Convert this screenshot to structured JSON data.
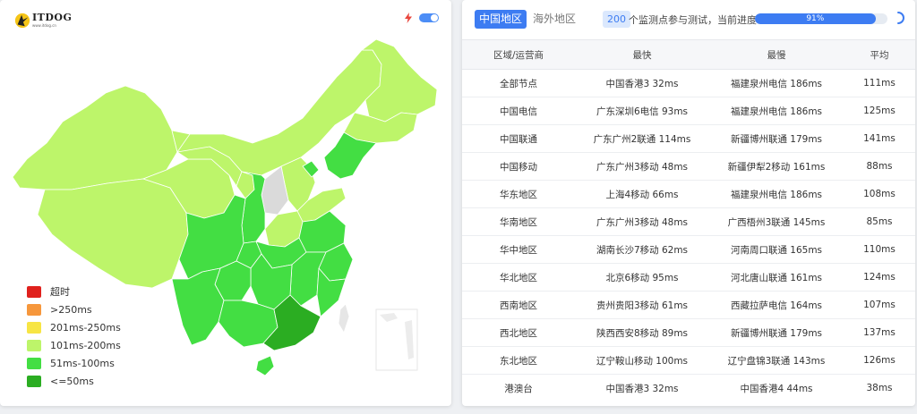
{
  "logo": {
    "text": "ITDOG",
    "subtext": "www.itdog.cn",
    "icon": "itdog-star-icon"
  },
  "toggle": {
    "icon": "lightning-icon",
    "on": true
  },
  "legend": [
    {
      "label": "超时",
      "color": "#e0211d"
    },
    {
      "label": ">250ms",
      "color": "#f6973c"
    },
    {
      "label": "201ms-250ms",
      "color": "#f7e544"
    },
    {
      "label": "101ms-200ms",
      "color": "#bdf56a"
    },
    {
      "label": "51ms-100ms",
      "color": "#43de43"
    },
    {
      "label": "<=50ms",
      "color": "#2bad22"
    }
  ],
  "tabs": [
    {
      "label": "中国地区",
      "active": true
    },
    {
      "label": "海外地区",
      "active": false
    }
  ],
  "status": {
    "count": "200",
    "text": "个监测点参与测试，当前进度：",
    "progress_label": "91%",
    "progress_value": 0.91
  },
  "table": {
    "headers": [
      "区域/运营商",
      "最快",
      "最慢",
      "平均"
    ],
    "rows": [
      [
        "全部节点",
        "中国香港3 32ms",
        "福建泉州电信 186ms",
        "111ms"
      ],
      [
        "中国电信",
        "广东深圳6电信 93ms",
        "福建泉州电信 186ms",
        "125ms"
      ],
      [
        "中国联通",
        "广东广州2联通 114ms",
        "新疆博州联通 179ms",
        "141ms"
      ],
      [
        "中国移动",
        "广东广州3移动 48ms",
        "新疆伊犁2移动 161ms",
        "88ms"
      ],
      [
        "华东地区",
        "上海4移动 66ms",
        "福建泉州电信 186ms",
        "108ms"
      ],
      [
        "华南地区",
        "广东广州3移动 48ms",
        "广西梧州3联通 145ms",
        "85ms"
      ],
      [
        "华中地区",
        "湖南长沙7移动 62ms",
        "河南周口联通 165ms",
        "110ms"
      ],
      [
        "华北地区",
        "北京6移动 95ms",
        "河北唐山联通 161ms",
        "124ms"
      ],
      [
        "西南地区",
        "贵州贵阳3移动 61ms",
        "西藏拉萨电信 164ms",
        "107ms"
      ],
      [
        "西北地区",
        "陕西西安8移动 89ms",
        "新疆博州联通 179ms",
        "137ms"
      ],
      [
        "东北地区",
        "辽宁鞍山移动 100ms",
        "辽宁盘锦3联通 143ms",
        "126ms"
      ],
      [
        "港澳台",
        "中国香港3 32ms",
        "中国香港4 44ms",
        "38ms"
      ]
    ]
  }
}
